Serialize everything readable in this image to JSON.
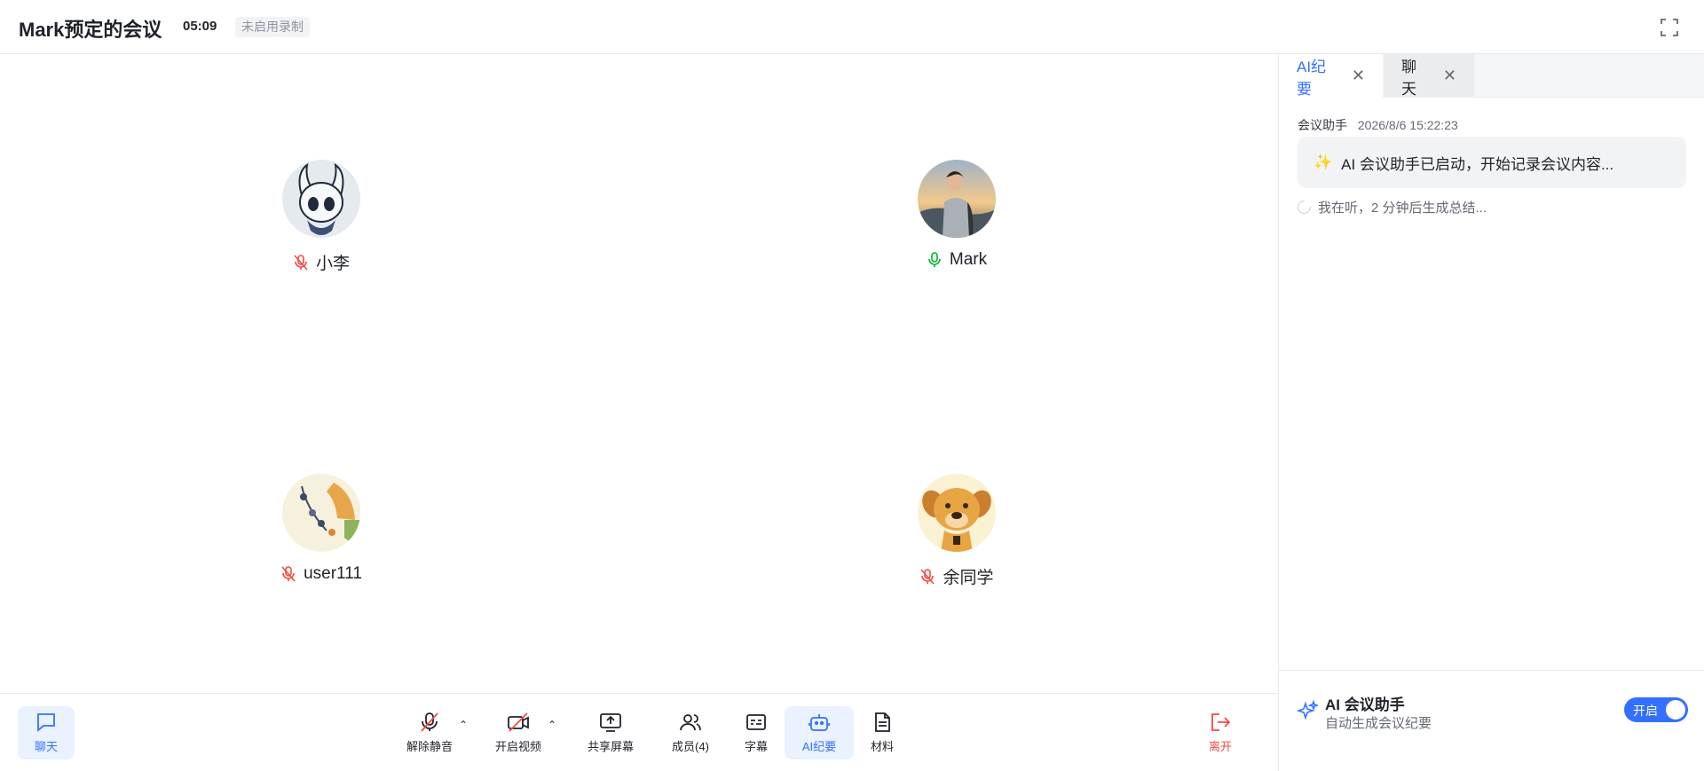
{
  "header": {
    "title": "Mark预定的会议",
    "timer": "05:09",
    "recording_status": "未启用录制"
  },
  "participants": [
    {
      "name": "小李",
      "mic": "muted",
      "avatar": "hollow-knight-avatar"
    },
    {
      "name": "Mark",
      "mic": "on",
      "avatar": "photo-avatar"
    },
    {
      "name": "user111",
      "mic": "muted",
      "avatar": "timeline-avatar"
    },
    {
      "name": "余同学",
      "mic": "muted",
      "avatar": "dog-avatar"
    }
  ],
  "side_panel": {
    "tabs": [
      {
        "label": "AI纪要",
        "active": true
      },
      {
        "label": "聊天",
        "active": false
      }
    ],
    "message": {
      "sender": "会议助手",
      "time": "2026/8/6 15:22:23",
      "emoji": "✨",
      "text": "AI 会议助手已启动，开始记录会议内容..."
    },
    "status": "我在听，2 分钟后生成总结...",
    "assistant": {
      "title": "AI 会议助手",
      "subtitle": "自动生成会议纪要",
      "toggle_label": "开启",
      "enabled": true
    }
  },
  "toolbar": {
    "chat": "聊天",
    "unmute": "解除静音",
    "video": "开启视频",
    "share": "共享屏幕",
    "members": "成员(4)",
    "captions": "字幕",
    "ai_notes": "AI纪要",
    "materials": "材料",
    "leave": "离开"
  },
  "colors": {
    "accent": "#3370ff",
    "danger": "#f54a45",
    "mic_on": "#00b42a"
  }
}
